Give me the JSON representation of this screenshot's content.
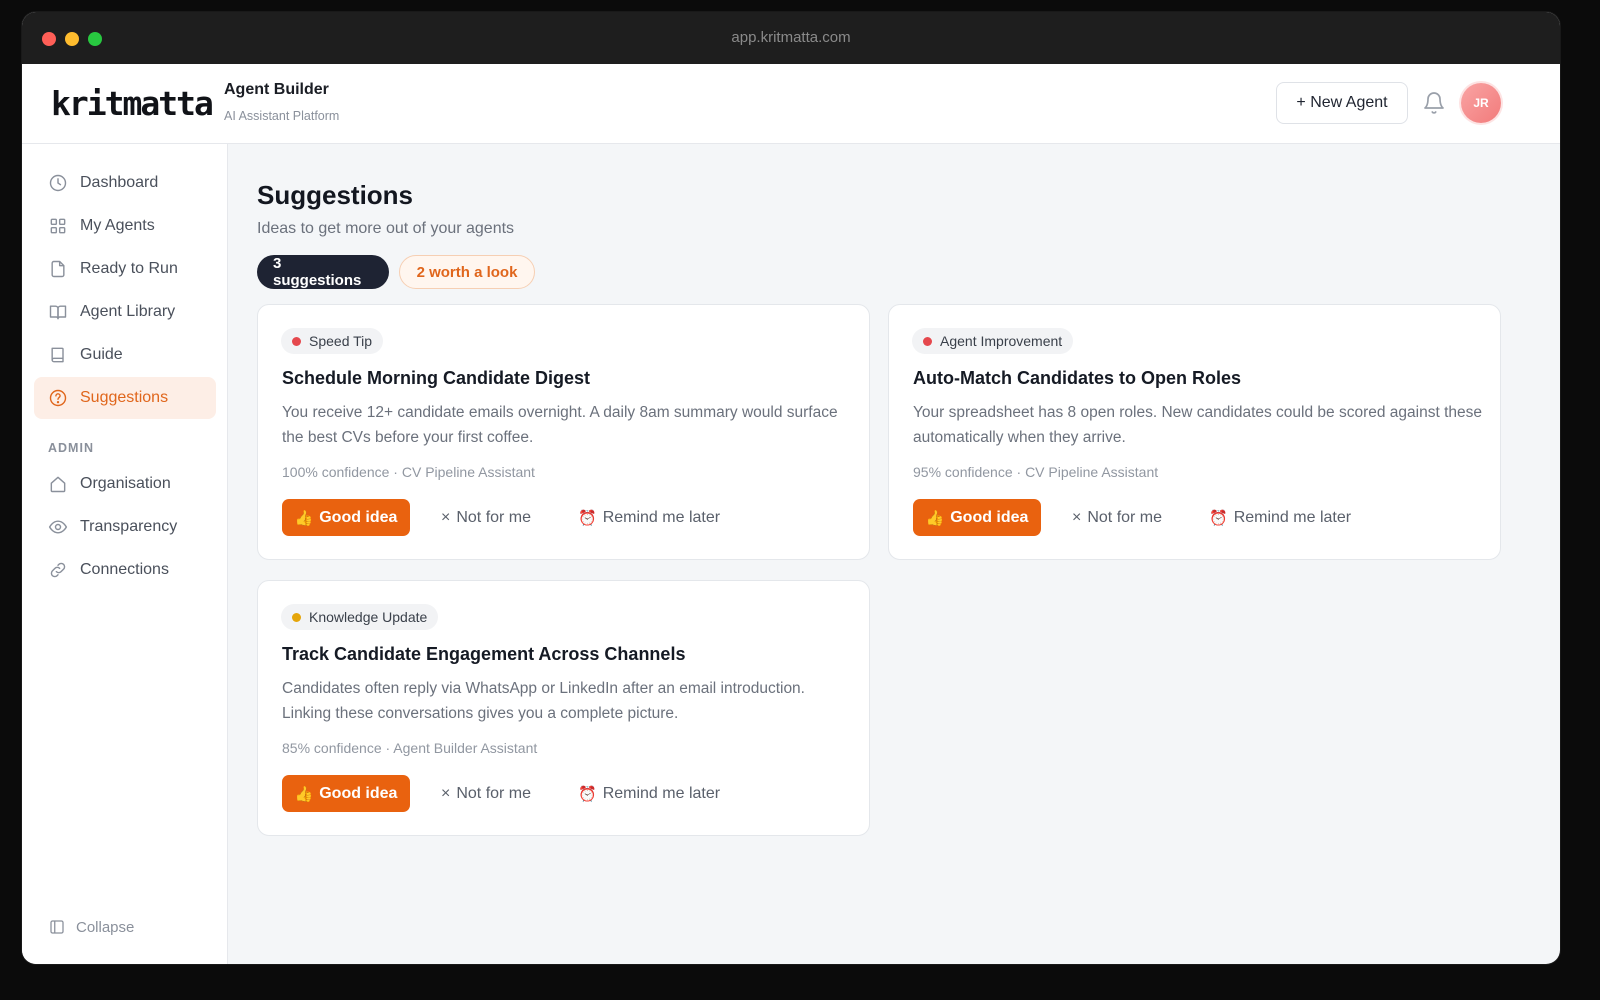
{
  "browser": {
    "url": "app.kritmatta.com"
  },
  "header": {
    "logo_text": "kritmatta",
    "title": "Agent Builder",
    "subtitle": "AI Assistant Platform",
    "new_agent_label": "+ New Agent",
    "avatar_initials": "JR",
    "icons": {
      "bell": "bell-icon"
    }
  },
  "sidebar": {
    "items": [
      {
        "label": "Dashboard",
        "icon": "clock-icon"
      },
      {
        "label": "My Agents",
        "icon": "grid-icon"
      },
      {
        "label": "Ready to Run",
        "icon": "file-icon"
      },
      {
        "label": "Agent Library",
        "icon": "book-open-icon"
      },
      {
        "label": "Guide",
        "icon": "book-icon"
      },
      {
        "label": "Suggestions",
        "icon": "help-circle-icon",
        "active": true
      }
    ],
    "admin_label": "ADMIN",
    "admin_items": [
      {
        "label": "Organisation",
        "icon": "home-icon"
      },
      {
        "label": "Transparency",
        "icon": "eye-icon"
      },
      {
        "label": "Connections",
        "icon": "link-icon"
      }
    ],
    "collapse_label": "Collapse"
  },
  "main": {
    "title": "Suggestions",
    "subtitle": "Ideas to get more out of your agents",
    "pills": {
      "count": "3 suggestions",
      "worth": "2 worth a look"
    },
    "actions": {
      "good": "Good idea",
      "not": "Not for me",
      "remind": "Remind me later"
    },
    "cards": [
      {
        "tag": "Speed Tip",
        "tag_color": "#e5484d",
        "title": "Schedule Morning Candidate Digest",
        "description": "You receive 12+ candidate emails overnight. A daily 8am summary would surface the best CVs before your first coffee.",
        "meta": "100% confidence · CV Pipeline Assistant"
      },
      {
        "tag": "Agent Improvement",
        "tag_color": "#e5484d",
        "title": "Auto-Match Candidates to Open Roles",
        "description": "Your spreadsheet has 8 open roles. New candidates could be scored against these automatically when they arrive.",
        "meta": "95% confidence · CV Pipeline Assistant"
      },
      {
        "tag": "Knowledge Update",
        "tag_color": "#e5a50a",
        "title": "Track Candidate Engagement Across Channels",
        "description": "Candidates often reply via WhatsApp or LinkedIn after an email introduction. Linking these conversations gives you a complete picture.",
        "meta": "85% confidence · Agent Builder Assistant"
      }
    ]
  },
  "colors": {
    "accent": "#e9620f",
    "dark_pill": "#1e2333",
    "active_nav_bg": "#fdeee6"
  }
}
